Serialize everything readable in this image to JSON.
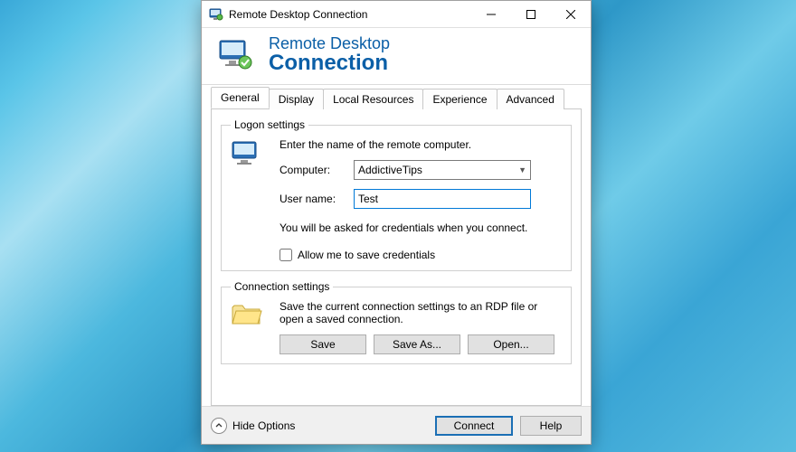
{
  "window": {
    "title": "Remote Desktop Connection"
  },
  "banner": {
    "line1": "Remote Desktop",
    "line2": "Connection"
  },
  "tabs": [
    {
      "label": "General"
    },
    {
      "label": "Display"
    },
    {
      "label": "Local Resources"
    },
    {
      "label": "Experience"
    },
    {
      "label": "Advanced"
    }
  ],
  "logon": {
    "legend": "Logon settings",
    "instruction": "Enter the name of the remote computer.",
    "computer_label": "Computer:",
    "computer_value": "AddictiveTips",
    "username_label": "User name:",
    "username_value": "Test",
    "note": "You will be asked for credentials when you connect.",
    "save_creds_label": "Allow me to save credentials"
  },
  "connection": {
    "legend": "Connection settings",
    "instruction": "Save the current connection settings to an RDP file or open a saved connection.",
    "save_label": "Save",
    "saveas_label": "Save As...",
    "open_label": "Open..."
  },
  "footer": {
    "hide_options": "Hide Options",
    "connect": "Connect",
    "help": "Help"
  }
}
